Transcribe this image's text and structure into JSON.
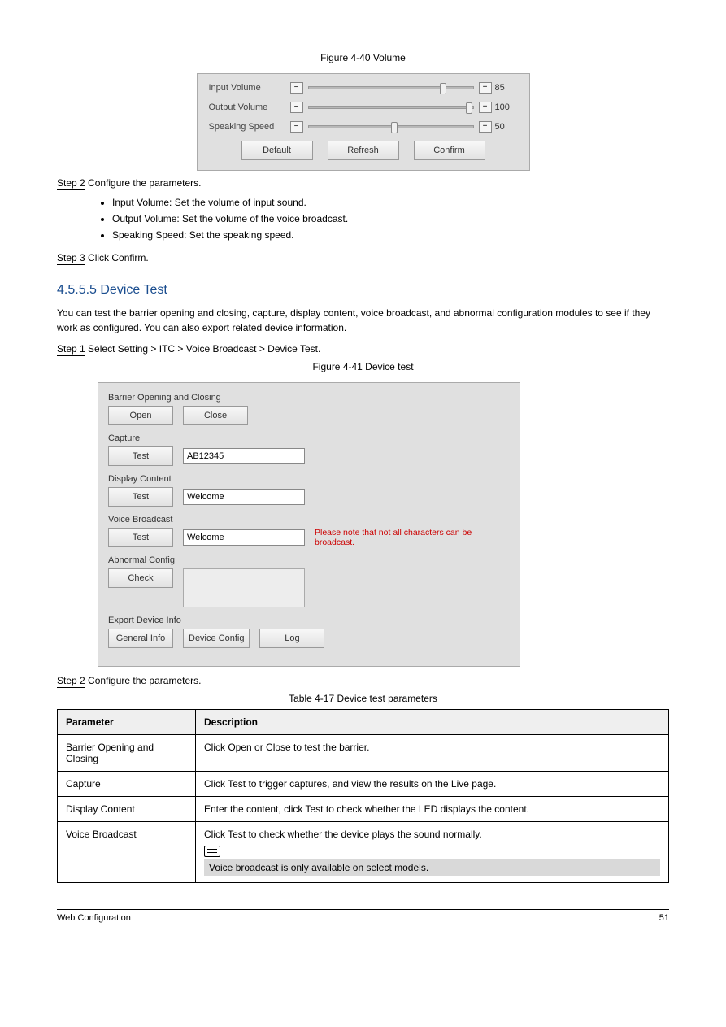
{
  "figure1_caption": "Figure 4-40 Volume",
  "volume": {
    "rows": [
      {
        "label": "Input Volume",
        "value": "85",
        "pos": 80
      },
      {
        "label": "Output Volume",
        "value": "100",
        "pos": 96
      },
      {
        "label": "Speaking Speed",
        "value": "50",
        "pos": 50
      }
    ],
    "buttons": {
      "default": "Default",
      "refresh": "Refresh",
      "confirm": "Confirm"
    }
  },
  "step2": {
    "no": "Step 2",
    "intro": "Configure the parameters.",
    "items": [
      "Input Volume: Set the volume of input sound.",
      "Output Volume: Set the volume of the voice broadcast.",
      "Speaking Speed: Set the speaking speed."
    ]
  },
  "step3": {
    "no": "Step 3",
    "text": "Click Confirm."
  },
  "heading": "4.5.5.5 Device Test",
  "intro": "You can test the barrier opening and closing, capture, display content, voice broadcast, and abnormal configuration modules to see if they work as configured. You can also export related device information.",
  "step1": {
    "no": "Step 1",
    "text": "Select Setting > ITC > Voice Broadcast > Device Test."
  },
  "figure2_caption": "Figure 4-41 Device test",
  "devtest": {
    "barrier_label": "Barrier Opening and Closing",
    "open": "Open",
    "close": "Close",
    "capture_label": "Capture",
    "test": "Test",
    "capture_value": "AB12345",
    "display_label": "Display Content",
    "display_value": "Welcome",
    "voice_label": "Voice Broadcast",
    "voice_value": "Welcome",
    "voice_warn": "Please note that not all characters can be broadcast.",
    "abnormal_label": "Abnormal Config",
    "check": "Check",
    "export_label": "Export Device Info",
    "general": "General Info",
    "config": "Device Config",
    "log": "Log"
  },
  "step2b": {
    "no": "Step 2",
    "text": "Configure the parameters."
  },
  "table_caption": "Table 4-17 Device test parameters",
  "table": {
    "head": {
      "p": "Parameter",
      "d": "Description"
    },
    "rows": [
      {
        "p": "Barrier Opening and Closing",
        "d": "Click Open or Close to test the barrier."
      },
      {
        "p": "Capture",
        "d": "Click Test to trigger captures, and view the results on the Live page."
      },
      {
        "p": "Display Content",
        "d": "Enter the content, click Test to check whether the LED displays the content."
      },
      {
        "p": "Voice Broadcast",
        "d_line": "Click Test to check whether the device plays the sound normally.",
        "note": "Voice broadcast is only available on select models."
      }
    ]
  },
  "footer": {
    "left": "Web Configuration",
    "right": "51"
  }
}
